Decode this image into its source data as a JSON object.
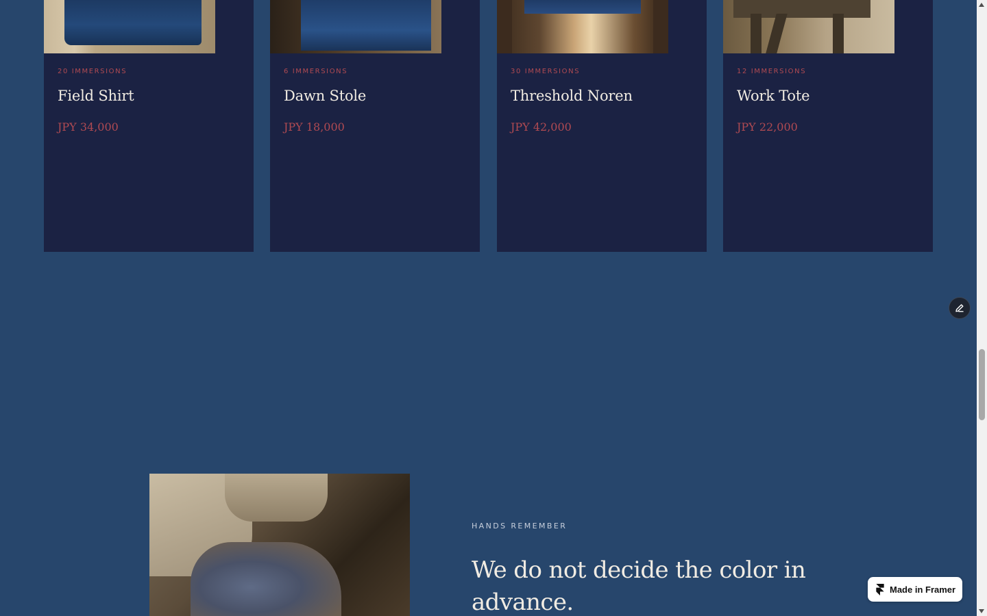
{
  "products": [
    {
      "immersions": "20 IMMERSIONS",
      "name": "Field Shirt",
      "price": "JPY 34,000"
    },
    {
      "immersions": "6 IMMERSIONS",
      "name": "Dawn Stole",
      "price": "JPY 18,000"
    },
    {
      "immersions": "30 IMMERSIONS",
      "name": "Threshold Noren",
      "price": "JPY 42,000"
    },
    {
      "immersions": "12 IMMERSIONS",
      "name": "Work Tote",
      "price": "JPY 22,000"
    }
  ],
  "story": {
    "kicker": "HANDS REMEMBER",
    "headline": "We do not decide the color in advance."
  },
  "badge": {
    "label": "Made in Framer"
  },
  "icons": {
    "edit": "pencil-icon",
    "framer": "framer-logo-icon"
  },
  "colors": {
    "page_bg": "#27466c",
    "card_bg": "#1b2243",
    "accent": "#b04a52",
    "text_light": "#f1ece3"
  }
}
